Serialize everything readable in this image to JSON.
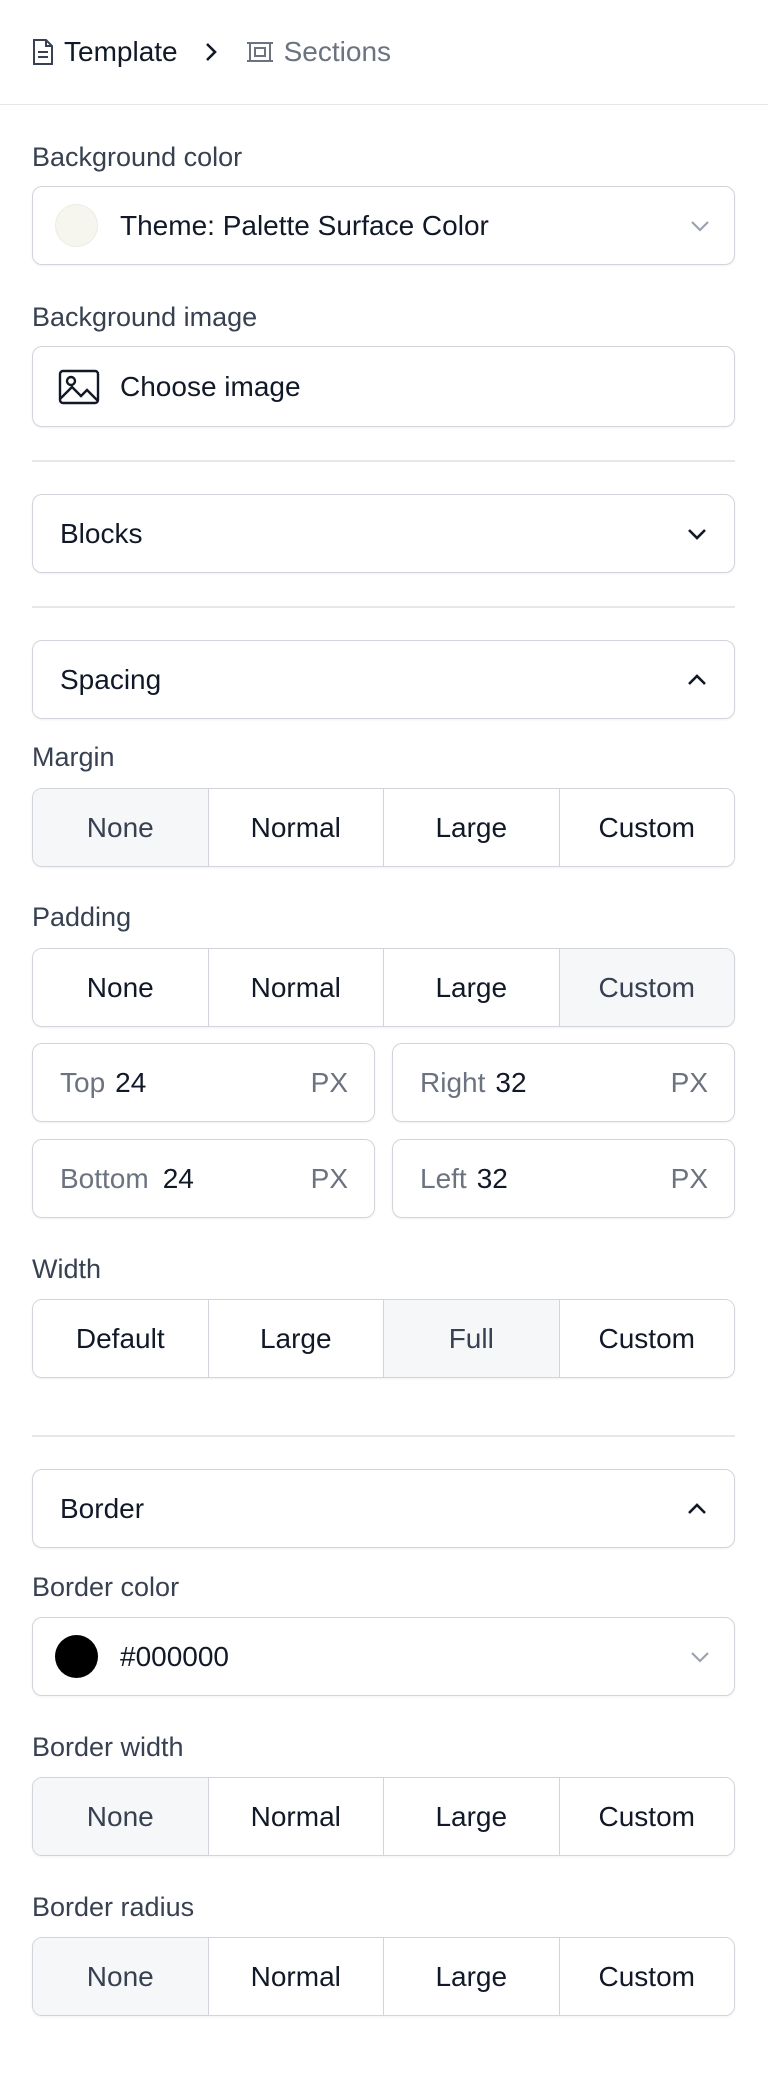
{
  "breadcrumb": {
    "current": "Template",
    "next": "Sections"
  },
  "background": {
    "color_label": "Background color",
    "color_value": "Theme: Palette Surface Color",
    "color_swatch": "#f6f6ee",
    "image_label": "Background image",
    "image_button": "Choose image"
  },
  "blocks": {
    "label": "Blocks"
  },
  "spacing": {
    "label": "Spacing",
    "margin": {
      "label": "Margin",
      "options": [
        "None",
        "Normal",
        "Large",
        "Custom"
      ],
      "selected": "None"
    },
    "padding": {
      "label": "Padding",
      "options": [
        "None",
        "Normal",
        "Large",
        "Custom"
      ],
      "selected": "Custom",
      "top": {
        "label": "Top",
        "value": "24",
        "unit": "PX"
      },
      "right": {
        "label": "Right",
        "value": "32",
        "unit": "PX"
      },
      "bottom": {
        "label": "Bottom",
        "value": "24",
        "unit": "PX"
      },
      "left": {
        "label": "Left",
        "value": "32",
        "unit": "PX"
      }
    },
    "width": {
      "label": "Width",
      "options": [
        "Default",
        "Large",
        "Full",
        "Custom"
      ],
      "selected": "Full"
    }
  },
  "border": {
    "label": "Border",
    "color_label": "Border color",
    "color_value": "#000000",
    "color_swatch": "#000000",
    "width": {
      "label": "Border width",
      "options": [
        "None",
        "Normal",
        "Large",
        "Custom"
      ],
      "selected": "None"
    },
    "radius": {
      "label": "Border radius",
      "options": [
        "None",
        "Normal",
        "Large",
        "Custom"
      ],
      "selected": "None"
    }
  }
}
